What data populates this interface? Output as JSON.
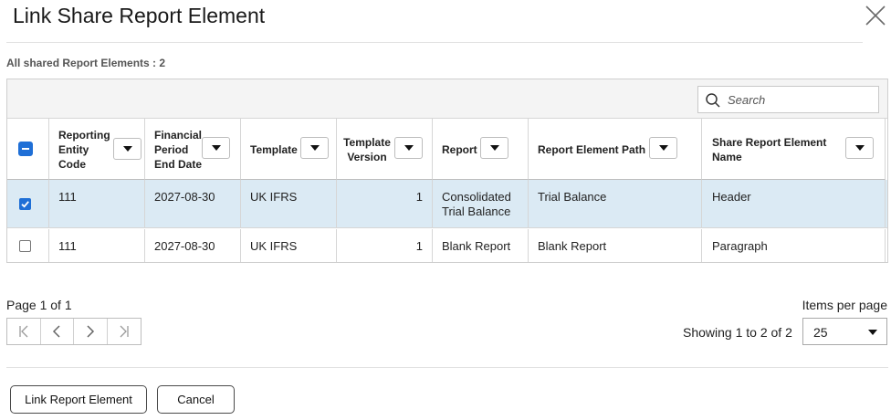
{
  "dialog": {
    "title": "Link Share Report Element",
    "summary": "All shared Report Elements : 2"
  },
  "search": {
    "placeholder": "Search"
  },
  "columns": [
    {
      "id": "reporting-entity-code",
      "lines": [
        "Reporting",
        "Entity",
        "Code"
      ]
    },
    {
      "id": "financial-period-end-date",
      "lines": [
        "Financial",
        "Period",
        "End Date"
      ]
    },
    {
      "id": "template",
      "lines": [
        "Template"
      ]
    },
    {
      "id": "template-version",
      "lines": [
        "Template",
        "Version"
      ]
    },
    {
      "id": "report",
      "lines": [
        "Report"
      ]
    },
    {
      "id": "report-element-path",
      "lines": [
        "Report Element Path"
      ]
    },
    {
      "id": "share-report-element-name",
      "lines": [
        "Share Report Element",
        "Name"
      ]
    }
  ],
  "rows": [
    {
      "selected": true,
      "entity": "111",
      "date": "2027-08-30",
      "template": "UK IFRS",
      "version": "1",
      "report": [
        "Consolidated",
        "Trial Balance"
      ],
      "path": "Trial Balance",
      "name": "Header"
    },
    {
      "selected": false,
      "entity": "111",
      "date": "2027-08-30",
      "template": "UK IFRS",
      "version": "1",
      "report": [
        "Blank Report"
      ],
      "path": "Blank Report",
      "name": "Paragraph"
    }
  ],
  "pagination": {
    "page_label": "Page 1 of 1",
    "items_per_page_label": "Items per page",
    "showing": "Showing 1 to 2 of 2",
    "items_per_page_value": "25"
  },
  "buttons": {
    "link": "Link Report Element",
    "cancel": "Cancel"
  }
}
